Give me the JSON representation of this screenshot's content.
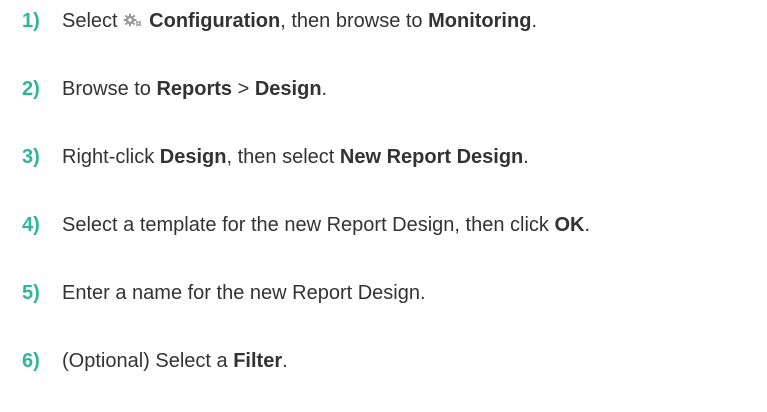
{
  "steps": [
    {
      "number": "1)",
      "parts": {
        "a": "Select ",
        "icon": "gear-icon",
        "b": "Configuration",
        "c": ", then browse to ",
        "d": "Monitoring",
        "e": "."
      }
    },
    {
      "number": "2)",
      "parts": {
        "a": "Browse to ",
        "b": "Reports",
        "c": " > ",
        "d": "Design",
        "e": "."
      }
    },
    {
      "number": "3)",
      "parts": {
        "a": "Right-click ",
        "b": "Design",
        "c": ", then select ",
        "d": "New Report Design",
        "e": "."
      }
    },
    {
      "number": "4)",
      "parts": {
        "a": "Select a template for the new Report Design, then click ",
        "b": "OK",
        "c": "."
      }
    },
    {
      "number": "5)",
      "parts": {
        "a": "Enter a name for the new Report Design."
      }
    },
    {
      "number": "6)",
      "parts": {
        "a": "(Optional) Select a ",
        "b": "Filter",
        "c": "."
      }
    }
  ],
  "colors": {
    "step_number": "#2fb59a",
    "text": "#333333",
    "icon": "#9a9a9a"
  }
}
